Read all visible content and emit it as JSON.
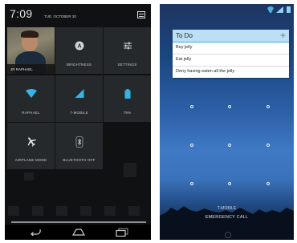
{
  "quick_settings": {
    "time": "7:09",
    "date": "TUE, OCTOBER 30",
    "tiles": {
      "user": "JR RAPHAEL",
      "brightness": "BRIGHTNESS",
      "settings": "SETTINGS",
      "wifi": "RAPHAEL",
      "mobile": "T-MOBILE",
      "battery": "79%",
      "airplane": "AIRPLANE MODE",
      "bluetooth": "BLUETOOTH OFF"
    },
    "nav": {
      "back_icon": "back-arrow-icon",
      "home_icon": "home-icon",
      "recents_icon": "recent-apps-icon"
    },
    "colors": {
      "background": "#0f1112",
      "tile": "#26292c",
      "accent": "#33b5e5"
    }
  },
  "lock_screen": {
    "widget": {
      "title": "To Do",
      "add_symbol": "+",
      "items": [
        "Buy jelly",
        "Eat jelly",
        "Deny having eaten all the jelly"
      ]
    },
    "carrier": "T-MOBILE",
    "emergency_label": "EMERGENCY CALL",
    "colors": {
      "status": "#8fd2f4",
      "widget_header": "#bcdff3"
    }
  }
}
